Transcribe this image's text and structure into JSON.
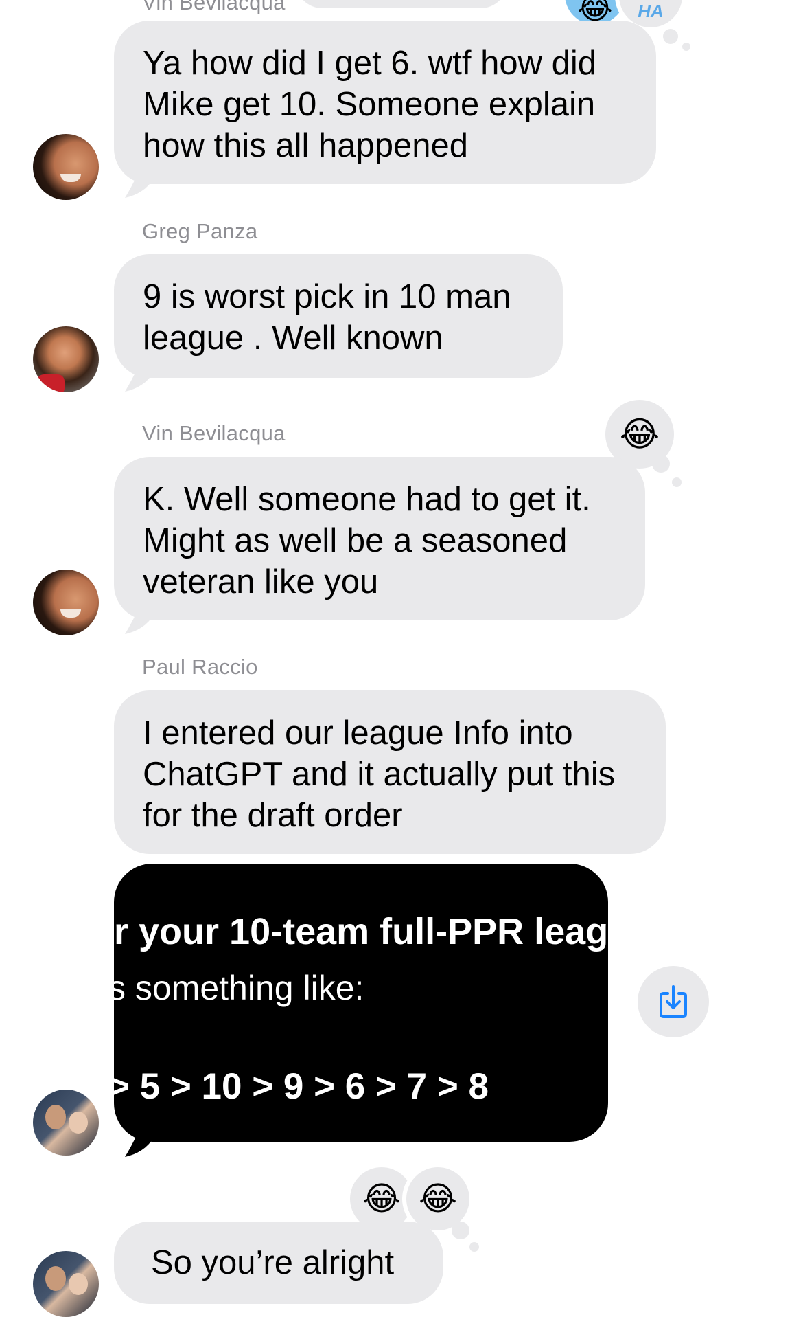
{
  "top_partial_sender": "Vin Bevilacqua",
  "messages": [
    {
      "lines": [
        "Ya how did I get 6. wtf how did",
        "Mike get 10. Someone explain",
        "how this all happened"
      ],
      "reaction": "ha-ha-icon"
    },
    {
      "sender": "Greg Panza",
      "lines": [
        "9 is worst pick in 10 man",
        "league . Well known"
      ]
    },
    {
      "sender": "Vin Bevilacqua",
      "lines": [
        "K. Well someone had to get it.",
        "Might as well be a seasoned",
        "veteran like you"
      ],
      "reaction": "😂"
    },
    {
      "sender": "Paul Raccio",
      "lines": [
        "I entered our league Info into",
        "ChatGPT and it actually put this",
        "for the draft order"
      ]
    },
    {
      "image_lines": [
        "r your 10-team full-PPR leag",
        "s something like:",
        "> 5 > 10 > 9 > 6 > 7 > 8"
      ]
    },
    {
      "lines": [
        "So you’re alright"
      ],
      "reactions": [
        "😂",
        "😂"
      ]
    }
  ],
  "icons": {
    "save": "save-to-photos-icon",
    "top_reaction_emoji": "😂",
    "top_reaction_ha": "HA"
  },
  "colors": {
    "bubble": "#e9e9eb",
    "sender_text": "#8e8e93",
    "save_icon": "#1a84ff",
    "image_bg": "#000000"
  }
}
